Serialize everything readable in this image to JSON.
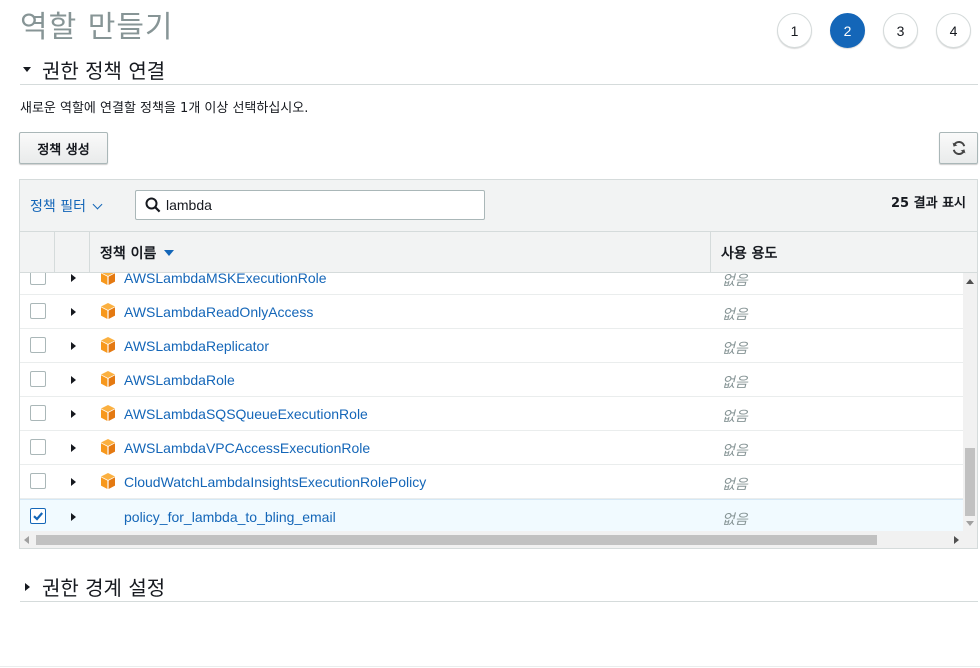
{
  "page": {
    "title": "역할 만들기"
  },
  "steps": [
    "1",
    "2",
    "3",
    "4"
  ],
  "active_step": "2",
  "section_permissions": {
    "title": "권한 정책 연결"
  },
  "description": "새로운 역할에 연결할 정책을 1개 이상 선택하십시오.",
  "buttons": {
    "create_policy": "정책 생성"
  },
  "filter": {
    "label": "정책 필터",
    "search_value": "lambda"
  },
  "result_count": "25 결과 표시",
  "columns": {
    "name": "정책 이름",
    "usage": "사용 용도"
  },
  "rows": [
    {
      "name": "AWSLambdaMSKExecutionRole",
      "usage": "없음",
      "aws_managed": true,
      "checked": false
    },
    {
      "name": "AWSLambdaReadOnlyAccess",
      "usage": "없음",
      "aws_managed": true,
      "checked": false
    },
    {
      "name": "AWSLambdaReplicator",
      "usage": "없음",
      "aws_managed": true,
      "checked": false
    },
    {
      "name": "AWSLambdaRole",
      "usage": "없음",
      "aws_managed": true,
      "checked": false
    },
    {
      "name": "AWSLambdaSQSQueueExecutionRole",
      "usage": "없음",
      "aws_managed": true,
      "checked": false
    },
    {
      "name": "AWSLambdaVPCAccessExecutionRole",
      "usage": "없음",
      "aws_managed": true,
      "checked": false
    },
    {
      "name": "CloudWatchLambdaInsightsExecutionRolePolicy",
      "usage": "없음",
      "aws_managed": true,
      "checked": false
    },
    {
      "name": "policy_for_lambda_to_bling_email",
      "usage": "없음",
      "aws_managed": false,
      "checked": true
    }
  ],
  "section_boundary": {
    "title": "권한 경계 설정"
  },
  "colors": {
    "accent": "#1466b8",
    "aws_icon": "#f7981d",
    "muted": "#879596"
  }
}
